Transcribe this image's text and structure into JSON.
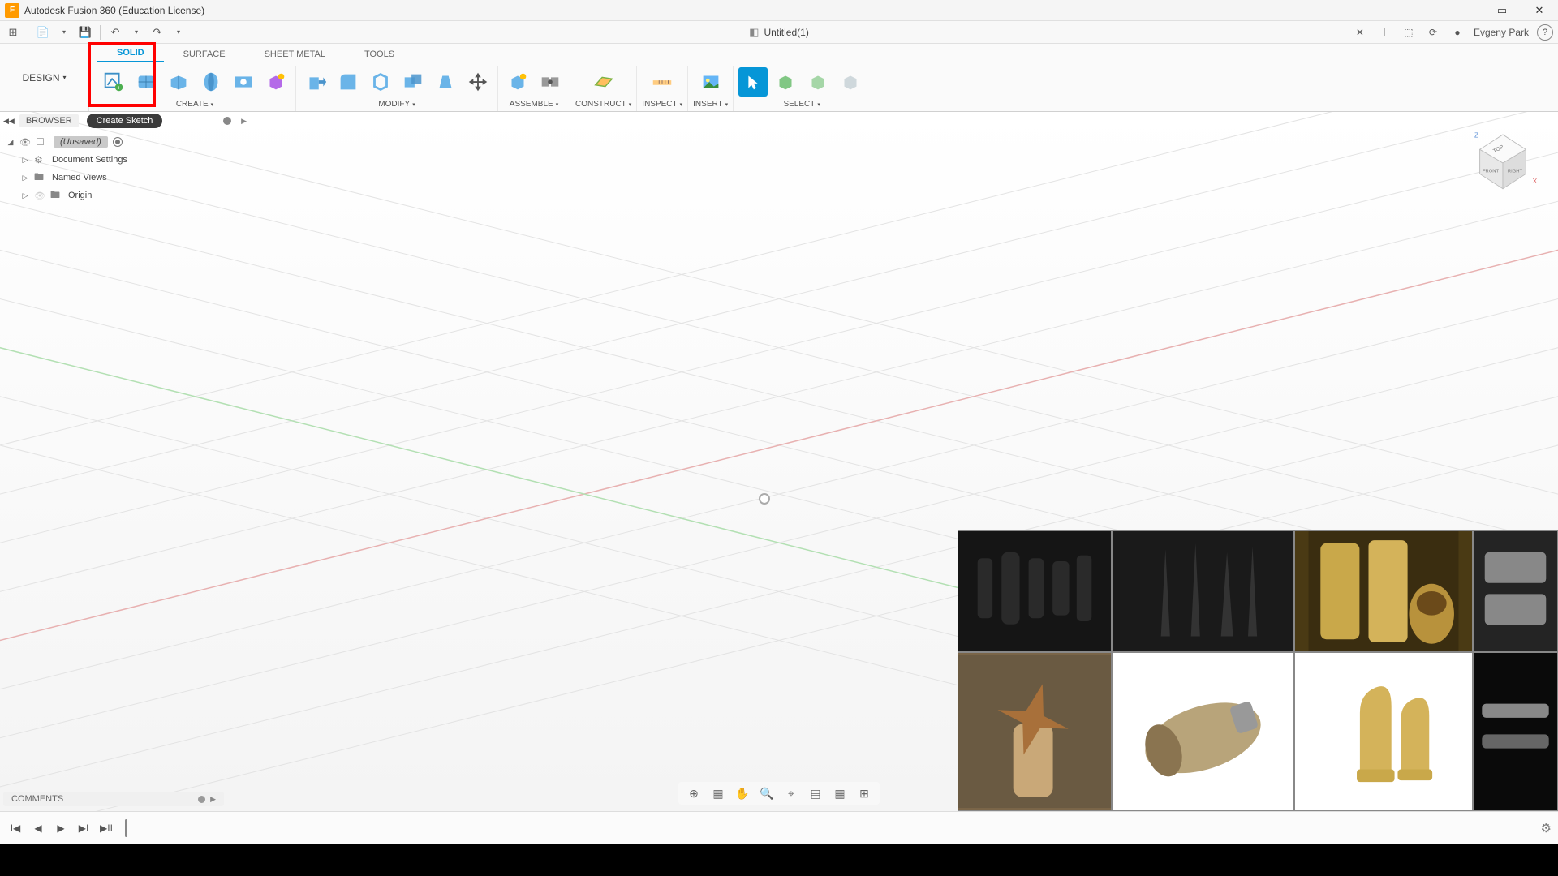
{
  "app": {
    "title": "Autodesk Fusion 360 (Education License)",
    "logo_letter": "F"
  },
  "window_controls": {
    "min": "—",
    "max": "▭",
    "close": "✕"
  },
  "qat": {
    "grid": "⊞",
    "file": "📄",
    "save": "💾",
    "undo": "↶",
    "redo": "↷",
    "dd": "▾"
  },
  "document": {
    "tab_title": "Untitled(1)",
    "close": "✕",
    "new": "＋"
  },
  "top_right": {
    "ext": "⬚",
    "updates": "⟳",
    "notif": "●",
    "user": "Evgeny Park",
    "help": "?"
  },
  "workspace": {
    "label": "DESIGN",
    "dd": "▾"
  },
  "ribbon_tabs": {
    "solid": "SOLID",
    "surface": "SURFACE",
    "sheet": "SHEET METAL",
    "tools": "TOOLS"
  },
  "ribbon_groups": {
    "create": "CREATE",
    "modify": "MODIFY",
    "assemble": "ASSEMBLE",
    "construct": "CONSTRUCT",
    "inspect": "INSPECT",
    "insert": "INSERT",
    "select": "SELECT",
    "dd": "▾"
  },
  "tooltip": {
    "create_sketch": "Create Sketch"
  },
  "browser": {
    "header": "BROWSER",
    "root": "(Unsaved)",
    "doc_settings": "Document Settings",
    "named_views": "Named Views",
    "origin": "Origin"
  },
  "viewcube": {
    "top": "TOP",
    "front": "FRONT",
    "right": "RIGHT",
    "z": "Z",
    "x": "X"
  },
  "comments": {
    "label": "COMMENTS"
  },
  "timeline": {
    "first": "|◀",
    "prev": "◀",
    "play": "▶",
    "next": "▶|",
    "last": "▶||",
    "gear": "⚙"
  },
  "navbar": {
    "orbit": "⊕",
    "look": "▦",
    "pan": "✋",
    "zoom": "🔍",
    "fit": "⌖",
    "disp": "▤",
    "grid": "▦",
    "vp": "⊞",
    "dd": "▾"
  }
}
